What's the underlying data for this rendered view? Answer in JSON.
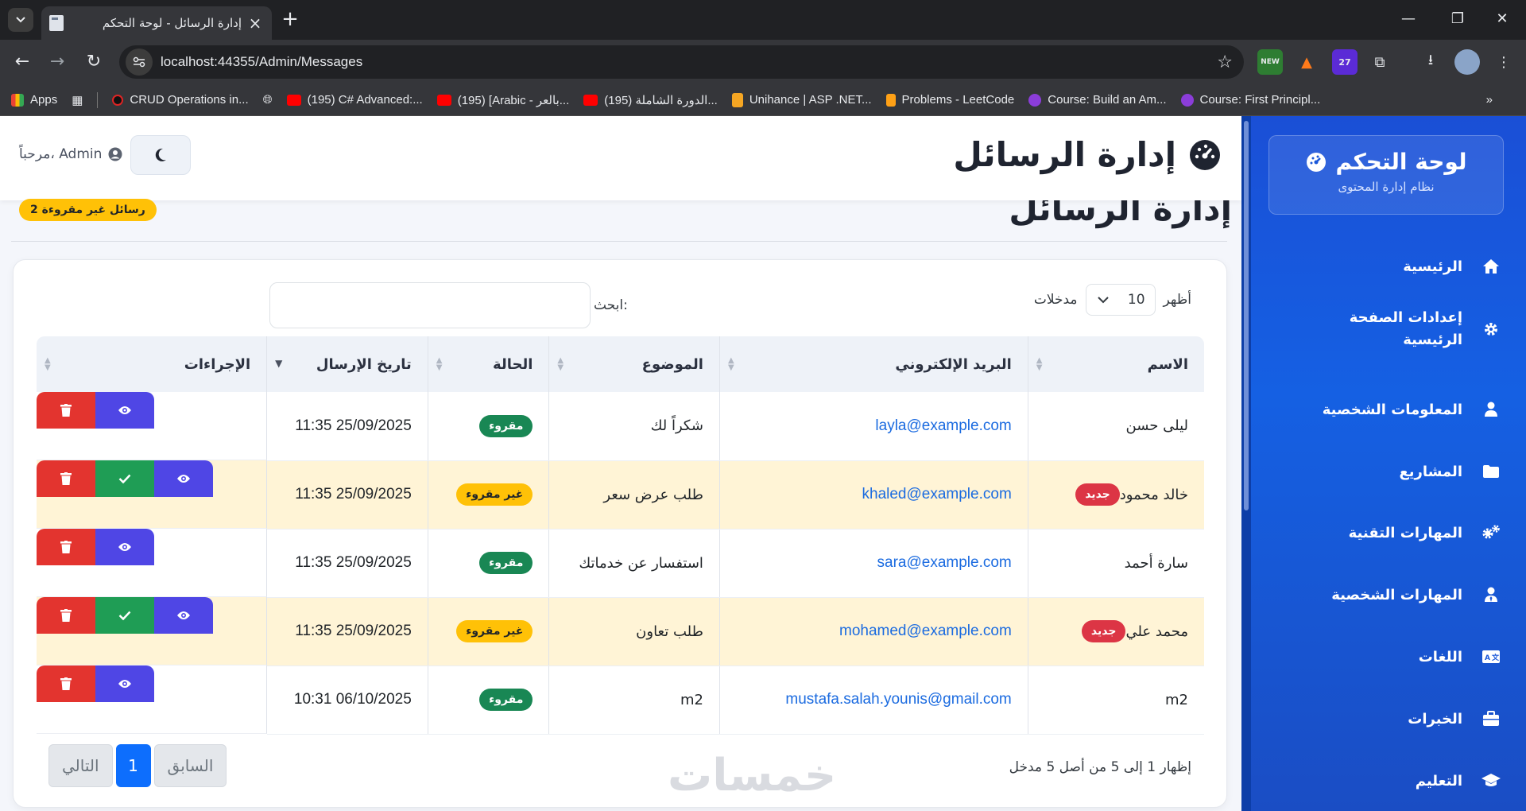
{
  "browser": {
    "tab_title": "إدارة الرسائل - لوحة التحكم",
    "url": "localhost:44355/Admin/Messages",
    "ext_badge": "27",
    "ext_new": "NEW",
    "bookmarks": [
      {
        "label": "Apps",
        "color": "#ea4335"
      },
      {
        "label": "CRUD Operations in...",
        "color": "#111111"
      },
      {
        "label": "(195) C# Advanced:...",
        "color": "#ff0000"
      },
      {
        "label": "(195) [Arabic - بالعر...",
        "color": "#ff0000"
      },
      {
        "label": "(195) الدورة الشاملة...",
        "color": "#ff0000"
      },
      {
        "label": "Unihance | ASP .NET...",
        "color": "#f5a623"
      },
      {
        "label": "Problems - LeetCode",
        "color": "#ffa116"
      },
      {
        "label": "Course: Build an Am...",
        "color": "#8b3dd9"
      },
      {
        "label": "Course: First Principl...",
        "color": "#8b3dd9"
      }
    ]
  },
  "sidebar": {
    "brand_title": "لوحة التحكم",
    "brand_subtitle": "نظام إدارة المحتوى",
    "items": [
      {
        "label": "الرئيسية",
        "icon": "home-icon"
      },
      {
        "label": "إعدادات الصفحة الرئيسية",
        "icon": "gear-icon"
      },
      {
        "label": "المعلومات الشخصية",
        "icon": "user-icon"
      },
      {
        "label": "المشاريع",
        "icon": "folder-icon"
      },
      {
        "label": "المهارات التقنية",
        "icon": "gears-icon"
      },
      {
        "label": "المهارات الشخصية",
        "icon": "user-tie-icon"
      },
      {
        "label": "اللغات",
        "icon": "language-icon"
      },
      {
        "label": "الخبرات",
        "icon": "briefcase-icon"
      },
      {
        "label": "التعليم",
        "icon": "graduation-cap-icon"
      }
    ]
  },
  "header": {
    "title": "إدارة الرسائل",
    "welcome": "مرحباً، Admin"
  },
  "page": {
    "title": "إدارة الرسائل",
    "unread_badge": "2 رسائل غير مقروءة"
  },
  "table_controls": {
    "show_label": "أظهر",
    "entries_label": "مدخلات",
    "page_length": "10",
    "search_label": "ابحث:",
    "search_value": ""
  },
  "table": {
    "columns": [
      "الاسم",
      "البريد الإلكتروني",
      "الموضوع",
      "الحالة",
      "تاريخ الإرسال",
      "الإجراءات"
    ],
    "rows": [
      {
        "name": "ليلى حسن",
        "is_new": false,
        "new_label": "",
        "email": "layla@example.com",
        "subject": "شكراً لك",
        "status": "مقروء",
        "date": "11:35 25/09/2025"
      },
      {
        "name": "خالد محمود",
        "is_new": true,
        "new_label": "جديد",
        "email": "khaled@example.com",
        "subject": "طلب عرض سعر",
        "status": "غير مقروء",
        "date": "11:35 25/09/2025"
      },
      {
        "name": "سارة أحمد",
        "is_new": false,
        "new_label": "",
        "email": "sara@example.com",
        "subject": "استفسار عن خدماتك",
        "status": "مقروء",
        "date": "11:35 25/09/2025"
      },
      {
        "name": "محمد علي",
        "is_new": true,
        "new_label": "جديد",
        "email": "mohamed@example.com",
        "subject": "طلب تعاون",
        "status": "غير مقروء",
        "date": "11:35 25/09/2025"
      },
      {
        "name": "m2",
        "is_new": false,
        "new_label": "",
        "email": "mustafa.salah.younis@gmail.com",
        "subject": "m2",
        "status": "مقروء",
        "date": "10:31 06/10/2025"
      }
    ]
  },
  "footer": {
    "info": "إظهار 1 إلى 5 من أصل 5 مدخل",
    "prev": "السابق",
    "current_page": "1",
    "next": "التالي",
    "watermark": "خمسات"
  }
}
